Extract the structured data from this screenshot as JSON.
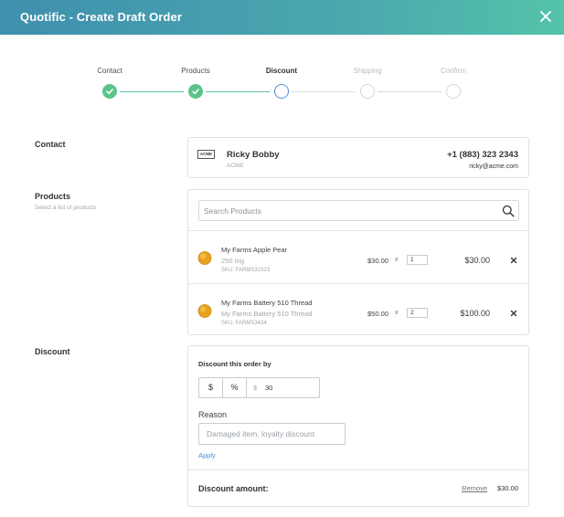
{
  "header": {
    "title": "Quotific - Create Draft Order",
    "close_icon": "close-icon"
  },
  "colors": {
    "header_start": "#3f8fae",
    "header_end": "#55c3aa",
    "done": "#5cc38a",
    "current": "#4b8fd6",
    "link": "#4b8fd6"
  },
  "stepper": {
    "steps": [
      {
        "label": "Contact",
        "state": "done"
      },
      {
        "label": "Products",
        "state": "done"
      },
      {
        "label": "Discount",
        "state": "current"
      },
      {
        "label": "Shipping",
        "state": "pending"
      },
      {
        "label": "Confirm",
        "state": "pending"
      }
    ]
  },
  "contact": {
    "section_title": "Contact",
    "logo_text": "ACME",
    "name": "Ricky Bobby",
    "company": "ACME",
    "phone": "+1 (883) 323 2343",
    "email": "ricky@acme.com"
  },
  "products": {
    "section_title": "Products",
    "section_subtitle": "Select a list of products",
    "search_placeholder": "Search Products",
    "items": [
      {
        "name": "My Farms Apple Pear",
        "variant": "250 mg",
        "sku": "SKU: FARMS32323",
        "unit_price": "$30.00",
        "times": "x",
        "qty": "1",
        "total": "$30.00"
      },
      {
        "name": "My Farms Battery 510 Thread",
        "variant": "My Farms Battery 510 Thread",
        "sku": "SKU: FARMS3434",
        "unit_price": "$50.00",
        "times": "x",
        "qty": "2",
        "total": "$100.00"
      }
    ]
  },
  "discount": {
    "section_title": "Discount",
    "card_title": "Discount this order by",
    "type_dollar": "$",
    "type_percent": "%",
    "currency_symbol": "$",
    "value": "30",
    "reason_label": "Reason",
    "reason_placeholder": "Damaged item, loyalty discount",
    "apply_label": "Apply",
    "amount_label": "Discount amount:",
    "remove_label": "Remove",
    "amount": "$30.00"
  }
}
